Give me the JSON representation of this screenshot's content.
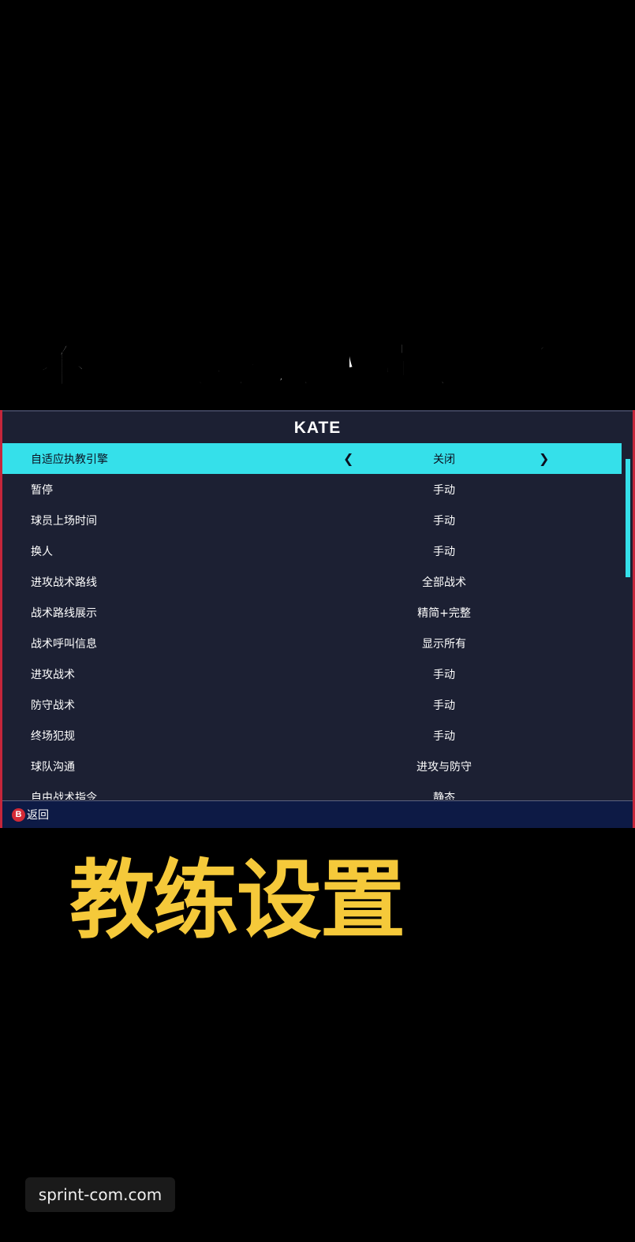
{
  "caption_top": "不要再抱怨说球员乱跑了",
  "panel": {
    "title": "KATE",
    "rows": [
      {
        "label": "自适应执教引擎",
        "value": "关闭",
        "selected": true
      },
      {
        "label": "暂停",
        "value": "手动"
      },
      {
        "label": "球员上场时间",
        "value": "手动"
      },
      {
        "label": "换人",
        "value": "手动"
      },
      {
        "label": "进攻战术路线",
        "value": "全部战术"
      },
      {
        "label": "战术路线展示",
        "value": "精简+完整"
      },
      {
        "label": "战术呼叫信息",
        "value": "显示所有"
      },
      {
        "label": "进攻战术",
        "value": "手动"
      },
      {
        "label": "防守战术",
        "value": "手动"
      },
      {
        "label": "终场犯规",
        "value": "手动"
      },
      {
        "label": "球队沟通",
        "value": "进攻与防守"
      },
      {
        "label": "自由战术指令",
        "value": "静态"
      }
    ],
    "arrow_left": "❮",
    "arrow_right": "❯",
    "footer": {
      "button_glyph": "B",
      "back_label": "返回"
    }
  },
  "caption_bottom": "教练设置",
  "watermark": "sprint-com.com",
  "colors": {
    "highlight": "#35e0ea",
    "panel_bg": "#1c2033",
    "footer_bg": "#0d1a45",
    "accent_red": "#c5263b",
    "title_yellow": "#f5c93a"
  }
}
